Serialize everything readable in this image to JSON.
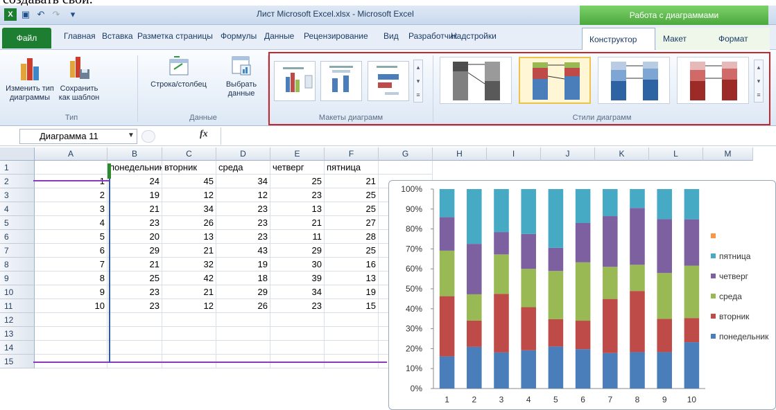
{
  "caption": "создавать свой.",
  "window": {
    "title": "Лист Microsoft Excel.xlsx - Microsoft Excel",
    "context_group": "Работа с диаграммами"
  },
  "tabs": {
    "file": "Файл",
    "main": [
      "Главная",
      "Вставка",
      "Разметка страницы",
      "Формулы",
      "Данные",
      "Рецензирование",
      "Вид",
      "Разработчик",
      "Надстройки"
    ],
    "context": [
      "Конструктор",
      "Макет",
      "Формат"
    ]
  },
  "ribbon": {
    "change_type": "Изменить тип\nдиаграммы",
    "save_template": "Сохранить\nкак шаблон",
    "group_type": "Тип",
    "row_col": "Строка/столбец",
    "select_data": "Выбрать\nданные",
    "group_data": "Данные",
    "group_layouts": "Макеты диаграмм",
    "group_styles": "Стили диаграмм"
  },
  "formula_bar": {
    "name_box": "Диаграмма 11",
    "fx": "fx"
  },
  "columns": [
    "A",
    "B",
    "C",
    "D",
    "E",
    "F",
    "G",
    "H",
    "I",
    "J",
    "K",
    "L",
    "M"
  ],
  "rows": [
    "1",
    "2",
    "3",
    "4",
    "5",
    "6",
    "7",
    "8",
    "9",
    "10",
    "11",
    "12",
    "13",
    "14",
    "15"
  ],
  "sheet": {
    "headers": [
      "понедельник",
      "вторник",
      "среда",
      "четверг",
      "пятница"
    ],
    "data": [
      [
        1,
        24,
        45,
        34,
        25,
        21
      ],
      [
        2,
        19,
        12,
        12,
        23,
        25
      ],
      [
        3,
        21,
        34,
        23,
        13,
        25
      ],
      [
        4,
        23,
        26,
        23,
        21,
        27
      ],
      [
        5,
        20,
        13,
        23,
        11,
        28
      ],
      [
        6,
        29,
        21,
        43,
        29,
        25
      ],
      [
        7,
        21,
        32,
        19,
        30,
        16
      ],
      [
        8,
        25,
        42,
        18,
        39,
        13
      ],
      [
        9,
        23,
        21,
        29,
        34,
        19
      ],
      [
        10,
        23,
        12,
        26,
        23,
        15
      ]
    ]
  },
  "colors": {
    "mon": "#4a7ebb",
    "tue": "#be4b48",
    "wed": "#98b954",
    "thu": "#7d60a0",
    "fri": "#46aac5",
    "extra": "#f79646"
  },
  "chart_data": {
    "type": "bar",
    "stacked": "percent",
    "categories": [
      "1",
      "2",
      "3",
      "4",
      "5",
      "6",
      "7",
      "8",
      "9",
      "10"
    ],
    "series": [
      {
        "name": "понедельник",
        "values": [
          24,
          19,
          21,
          23,
          20,
          29,
          21,
          25,
          23,
          23
        ]
      },
      {
        "name": "вторник",
        "values": [
          45,
          12,
          34,
          26,
          13,
          21,
          32,
          42,
          21,
          12
        ]
      },
      {
        "name": "среда",
        "values": [
          34,
          12,
          23,
          23,
          23,
          43,
          19,
          18,
          29,
          26
        ]
      },
      {
        "name": "четверг",
        "values": [
          25,
          23,
          13,
          21,
          11,
          29,
          30,
          39,
          34,
          23
        ]
      },
      {
        "name": "пятница",
        "values": [
          21,
          25,
          25,
          27,
          28,
          25,
          16,
          13,
          19,
          15
        ]
      }
    ],
    "yticks": [
      "0%",
      "10%",
      "20%",
      "30%",
      "40%",
      "50%",
      "60%",
      "70%",
      "80%",
      "90%",
      "100%"
    ],
    "legend": [
      "",
      "пятница",
      "четверг",
      "среда",
      "вторник",
      "понедельник"
    ],
    "ylim": [
      0,
      100
    ],
    "legend_position": "right"
  }
}
